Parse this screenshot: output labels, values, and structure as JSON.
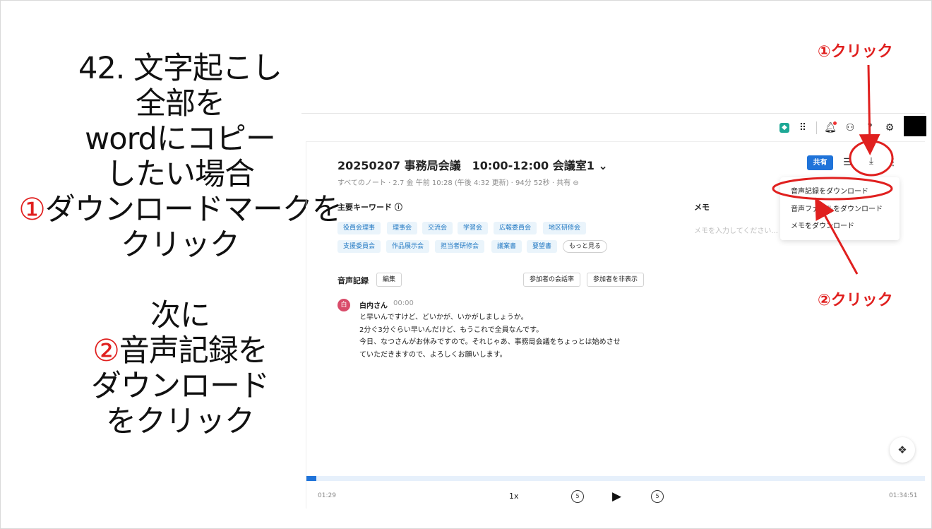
{
  "instructions": {
    "line1": "42. 文字起こし",
    "line2": "全部を",
    "line3": "wordにコピー",
    "line4": "したい場合",
    "line5_num": "①",
    "line5_text": "ダウンロードマークを",
    "line6": "クリック",
    "line7": "次に",
    "line8_num": "②",
    "line8_text": "音声記録を",
    "line9": "ダウンロード",
    "line10": "をクリック"
  },
  "annotations": {
    "step1": "①クリック",
    "step2": "②クリック",
    "color": "#e0201f"
  },
  "topbar": {
    "icons": [
      "app-logo-icon",
      "apps-grid-icon",
      "bell-icon",
      "network-icon",
      "help-icon",
      "gear-icon"
    ]
  },
  "note": {
    "title": "20250207 事務局会議　10:00-12:00 会議室1",
    "title_caret": "⌄",
    "meta": "すべてのノート · 2.7 金 午前 10:28 (午後 4:32 更新) · 94分 52秒 · 共有 ⊖"
  },
  "header_actions": {
    "share_label": "共有",
    "share_color": "#1f73d9"
  },
  "dropdown": {
    "items": [
      "音声記録をダウンロード",
      "音声ファイルをダウンロード",
      "メモをダウンロード"
    ]
  },
  "keywords": {
    "title": "主要キーワード",
    "info_icon": "ⓘ",
    "items": [
      "役員会理事",
      "理事会",
      "交流会",
      "学習会",
      "広報委員会",
      "地区研修会",
      "支援委員会",
      "作品展示会",
      "担当者研修会",
      "議案書",
      "要望書"
    ],
    "more_label": "もっと見る"
  },
  "memo": {
    "title": "メモ",
    "placeholder": "メモを入力してください..."
  },
  "recording": {
    "title": "音声記録",
    "edit_label": "編集",
    "rate_label": "参加者の会話率",
    "hide_label": "参加者を非表示"
  },
  "transcript": {
    "avatar": "白",
    "speaker": "白内さん",
    "time": "00:00",
    "lines": [
      "と早いんですけど、どいかが、いかがしましょうか。",
      "2分ぐ3分ぐらい早いんだけど、もうこれで全員なんです。",
      "今日、なつさんがお休みですので。それじゃあ、事務局会議をちょっとは始めさせ",
      "ていただきますので、よろしくお願いします。"
    ]
  },
  "player": {
    "current_time": "01:29",
    "total_time": "01:34:51",
    "speed": "1x",
    "skip_back": "5",
    "skip_forward": "5",
    "progress_fraction": 0.016
  }
}
